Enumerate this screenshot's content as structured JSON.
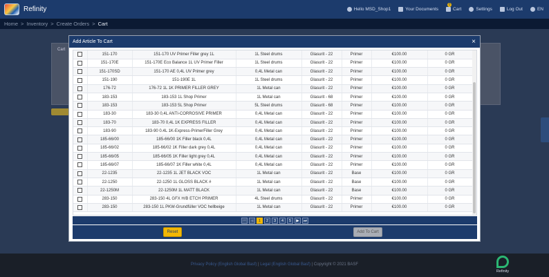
{
  "app": {
    "brand": "Refinity"
  },
  "topnav": {
    "greeting": "Hello MSD_Shop1",
    "documents": "Your Documents",
    "cart": "Cart",
    "cart_count": "0",
    "settings": "Settings",
    "logout": "Log Out",
    "language": "EN"
  },
  "breadcrumb": [
    "Home",
    "Inventory",
    "Create Orders",
    "Cart"
  ],
  "background": {
    "card_title": "Cart"
  },
  "modal": {
    "title": "Add Article To Cart",
    "close": "×",
    "rows": [
      [
        "151-170",
        "151-170 UV Primer Filler grey 1L",
        "1L Steel drums",
        "Glasurit - 22",
        "Primer",
        "€100.00",
        "0 GR"
      ],
      [
        "151-170E",
        "151-170E Eco Balance 1L UV Primer Filler",
        "1L Steel drums",
        "Glasurit - 22",
        "Primer",
        "€100.00",
        "0 GR"
      ],
      [
        "151-170SD",
        "151-170 AE 0,4L UV Primer grey",
        "0,4L Metal can",
        "Glasurit - 22",
        "Primer",
        "€100.00",
        "0 GR"
      ],
      [
        "151-190",
        "151-190E 1L",
        "1L Steel drums",
        "Glasurit - 22",
        "Primer",
        "€100.00",
        "0 GR"
      ],
      [
        "176-72",
        "176-72 1L 1K PRIMER FILLER GREY",
        "1L Metal can",
        "Glasurit - 22",
        "Primer",
        "€100.00",
        "0 GR"
      ],
      [
        "183-153",
        "183-153 1L Shop Primer",
        "1L Metal can",
        "Glasurit - 68",
        "Primer",
        "€100.00",
        "0 GR"
      ],
      [
        "183-153",
        "183-153 5L Shop Primer",
        "5L Steel drums",
        "Glasurit - 68",
        "Primer",
        "€100.00",
        "0 GR"
      ],
      [
        "183-30",
        "183-30 0,4L ANTI-CORROSIVE PRIMER",
        "0,4L Metal can",
        "Glasurit - 22",
        "Primer",
        "€100.00",
        "0 GR"
      ],
      [
        "183-70",
        "183-70 0,4L 1K EXPRESS FILLER",
        "0,4L Metal can",
        "Glasurit - 22",
        "Primer",
        "€100.00",
        "0 GR"
      ],
      [
        "183-90",
        "183-90 0.4L 1K-Express-PrimerFiller Grey",
        "0,4L Metal can",
        "Glasurit - 22",
        "Primer",
        "€100.00",
        "0 GR"
      ],
      [
        "185-66/00",
        "185-66/00 1K Filler black 0,4L",
        "0,4L Metal can",
        "Glasurit - 22",
        "Primer",
        "€100.00",
        "0 GR"
      ],
      [
        "185-66/02",
        "185-66/02 1K Filler dark grey 0,4L",
        "0,4L Metal can",
        "Glasurit - 22",
        "Primer",
        "€100.00",
        "0 GR"
      ],
      [
        "185-66/05",
        "185-66/05 1K Filler light grey 0,4L",
        "0,4L Metal can",
        "Glasurit - 22",
        "Primer",
        "€100.00",
        "0 GR"
      ],
      [
        "185-66/07",
        "185-66/07 1K Filler white 0,4L",
        "0,4L Metal can",
        "Glasurit - 22",
        "Primer",
        "€100.00",
        "0 GR"
      ],
      [
        "22-1235",
        "22-1235 1L JET BLACK VOC",
        "1L Metal can",
        "Glasurit - 22",
        "Base",
        "€100.00",
        "0 GR"
      ],
      [
        "22-1250",
        "22-1250 1L GLOSS BLACK #",
        "1L Metal can",
        "Glasurit - 22",
        "Base",
        "€100.00",
        "0 GR"
      ],
      [
        "22-1250M",
        "22-1250M 1L MATT BLACK",
        "1L Metal can",
        "Glasurit - 22",
        "Base",
        "€100.00",
        "0 GR"
      ],
      [
        "283-150",
        "283-150 4L GFX H/B ETCH PRIMER",
        "4L Steel drums",
        "Glasurit - 22",
        "Primer",
        "€100.00",
        "0 GR"
      ],
      [
        "283-150",
        "283-150 1L PKW-Grundfüller VOC hellbeige",
        "1L Metal can",
        "Glasurit - 22",
        "Primer",
        "€100.00",
        "0 GR"
      ]
    ],
    "pager": {
      "first": "⏮",
      "prev": "◀",
      "pages": [
        "1",
        "2",
        "3",
        "4",
        "5"
      ],
      "next": "▶",
      "last": "⏭"
    },
    "reset_label": "Reset",
    "add_label": "Add To Cart"
  },
  "footer": {
    "privacy": "Privacy Policy (English Global Basf)",
    "legal": "Legal (English Global Basf)",
    "copyright": "Copyright © 2021 BASF",
    "brand": "Refinity"
  }
}
